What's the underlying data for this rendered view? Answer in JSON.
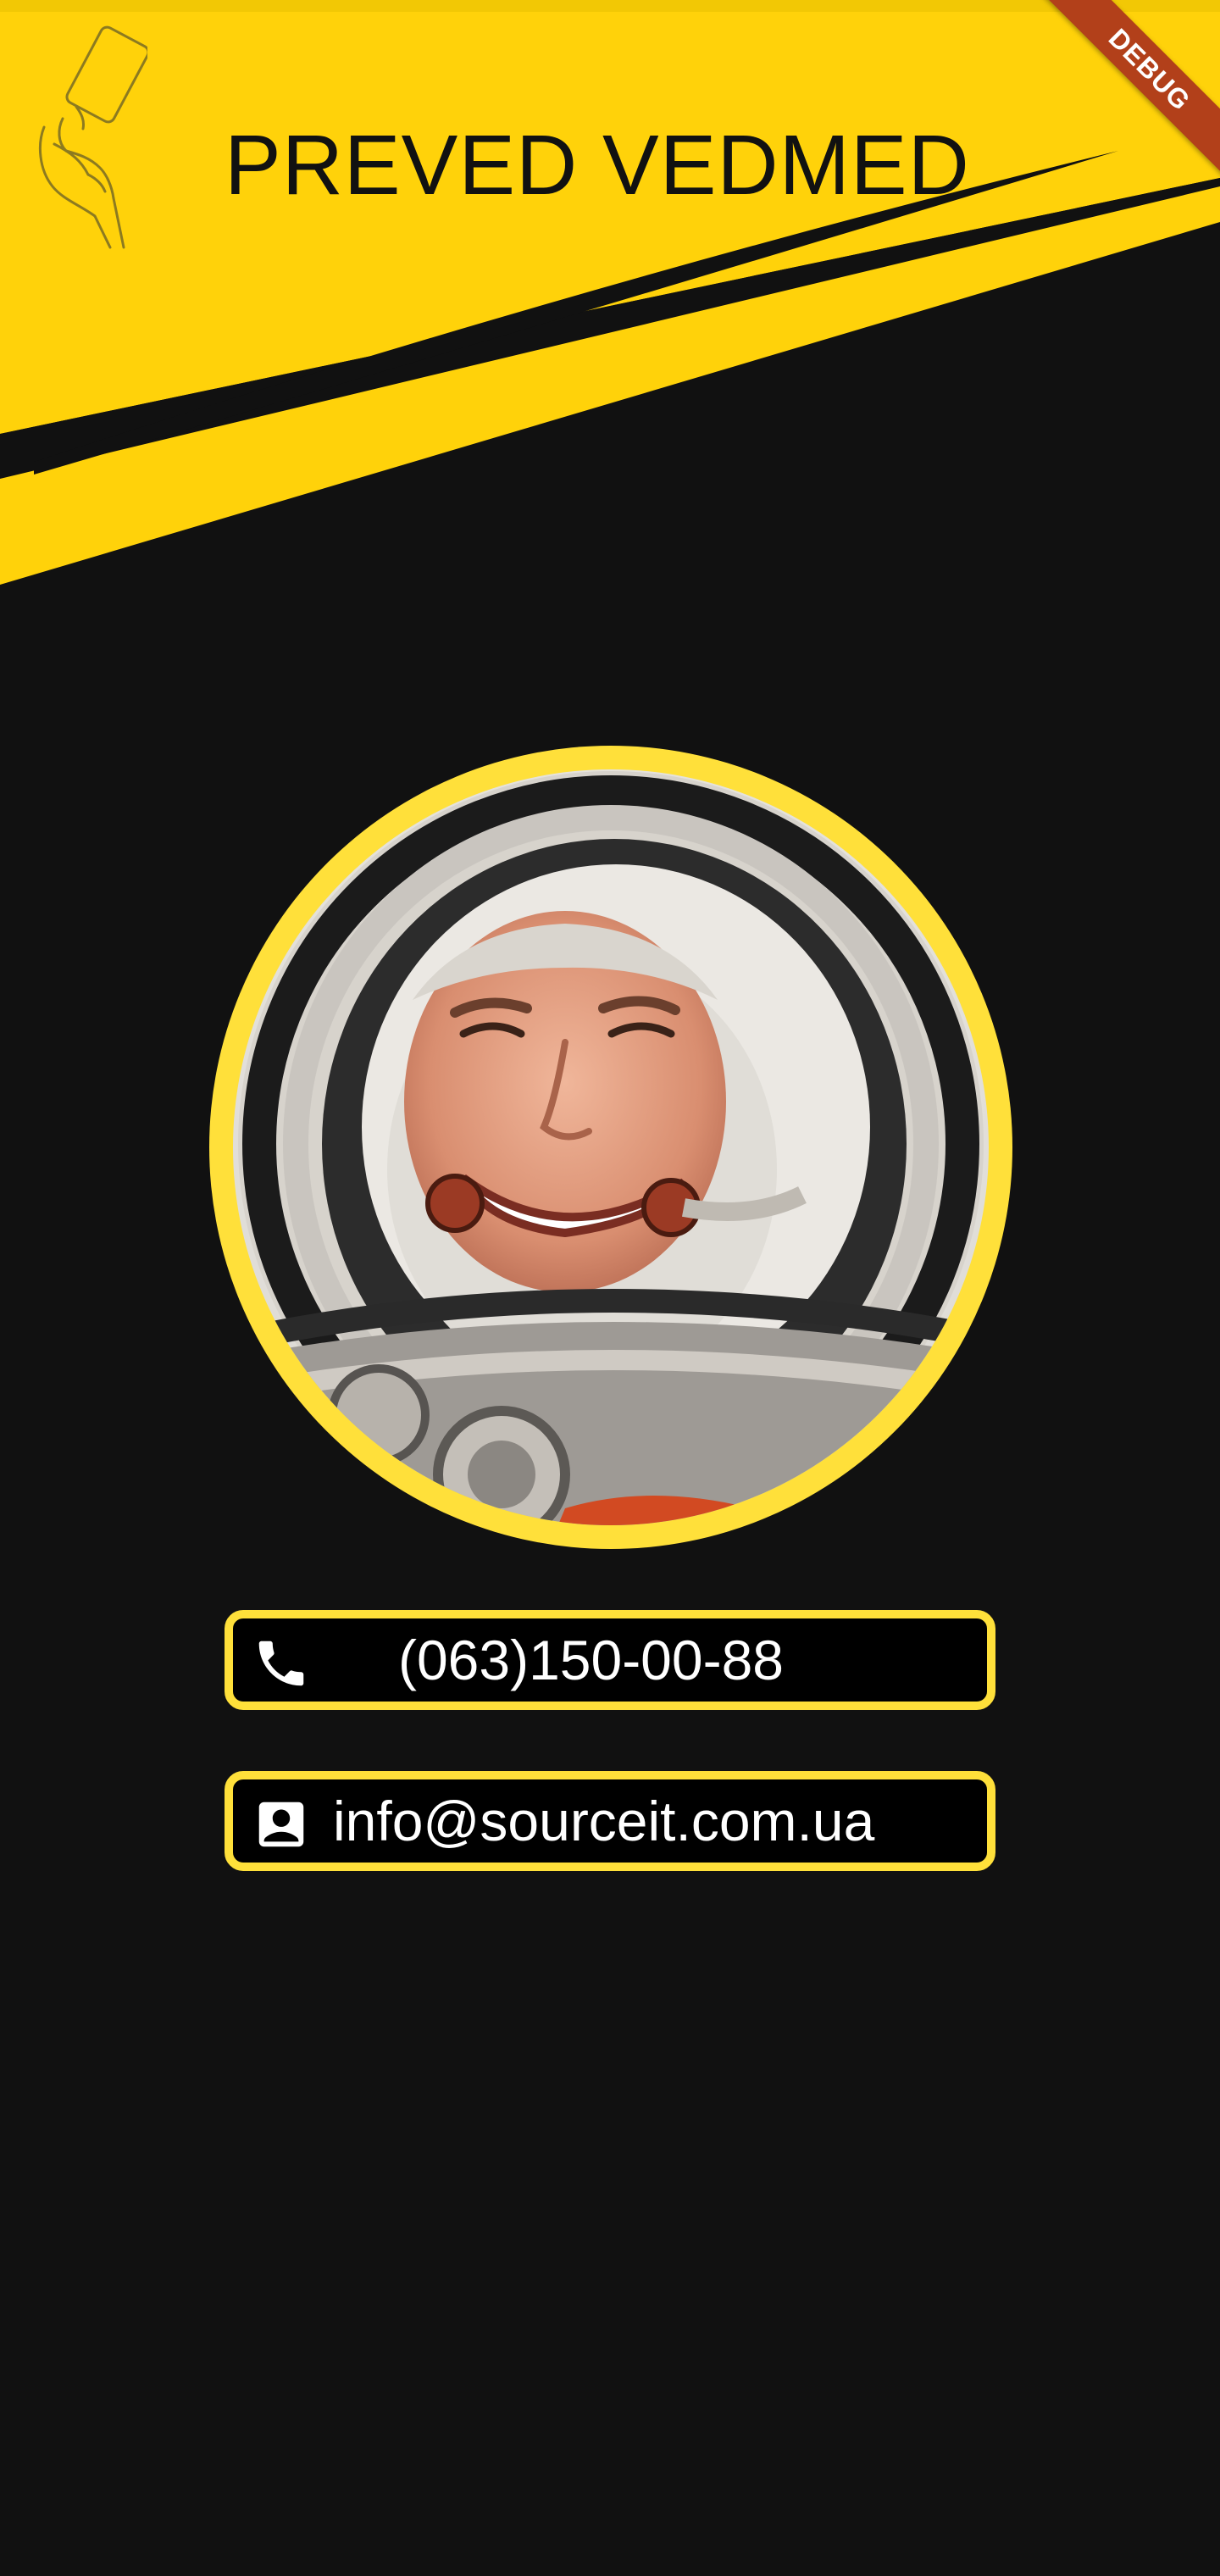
{
  "header": {
    "title": "PREVED VEDMED",
    "logo_icon": "hand-holding-card-icon",
    "background_color": "#ffd20a",
    "stripe_color": "#111111"
  },
  "debug_banner": {
    "label": "DEBUG",
    "color": "#b2401a"
  },
  "profile": {
    "avatar_icon": "astronaut-portrait",
    "frame_color": "#ffe03a"
  },
  "contacts": [
    {
      "icon": "phone-icon",
      "text": "(063)150-00-88"
    },
    {
      "icon": "contact-card-icon",
      "text": "info@sourceit.com.ua"
    }
  ],
  "colors": {
    "page_background": "#111111",
    "card_border": "#ffe03a",
    "card_background": "#000000",
    "card_text": "#ffffff"
  }
}
